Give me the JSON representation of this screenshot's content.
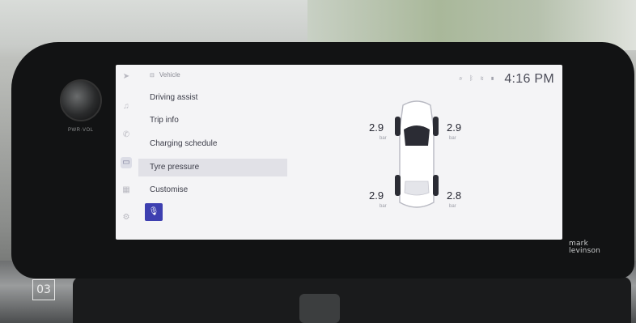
{
  "overlay": {
    "badge": "03",
    "knob_label": "PWR·VOL",
    "brand": "mark levinson"
  },
  "screen": {
    "breadcrumb": "Vehicle",
    "clock": "4:16 PM",
    "status_icons": [
      "mic-off-icon",
      "bluetooth-icon",
      "signal-icon",
      "battery-icon"
    ],
    "left_rail_icons": [
      "navigation-icon",
      "music-icon",
      "phone-icon",
      "car-icon",
      "apps-icon",
      "settings-icon"
    ],
    "menu": [
      {
        "label": "Driving assist",
        "selected": false
      },
      {
        "label": "Trip info",
        "selected": false
      },
      {
        "label": "Charging schedule",
        "selected": false
      },
      {
        "label": "Tyre pressure",
        "selected": true
      },
      {
        "label": "Customise",
        "selected": false
      }
    ],
    "tyre_pressure": {
      "front_left": {
        "value": "2.9",
        "unit": "bar"
      },
      "front_right": {
        "value": "2.9",
        "unit": "bar"
      },
      "rear_left": {
        "value": "2.9",
        "unit": "bar"
      },
      "rear_right": {
        "value": "2.8",
        "unit": "bar"
      }
    },
    "accent_color": "#3d3fb0"
  }
}
